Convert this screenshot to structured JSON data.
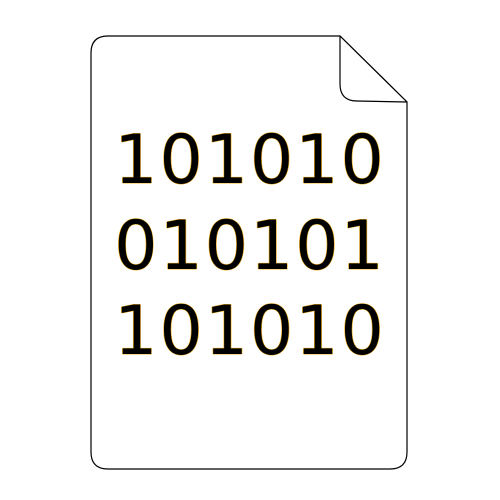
{
  "icon": {
    "name": "binary-file-icon",
    "binary_lines": [
      "101010",
      "010101",
      "101010"
    ],
    "colors": {
      "paper": "#ffffff",
      "outline": "#000000",
      "fold_shadow": "#c8c8c8",
      "text": "#000000"
    }
  }
}
